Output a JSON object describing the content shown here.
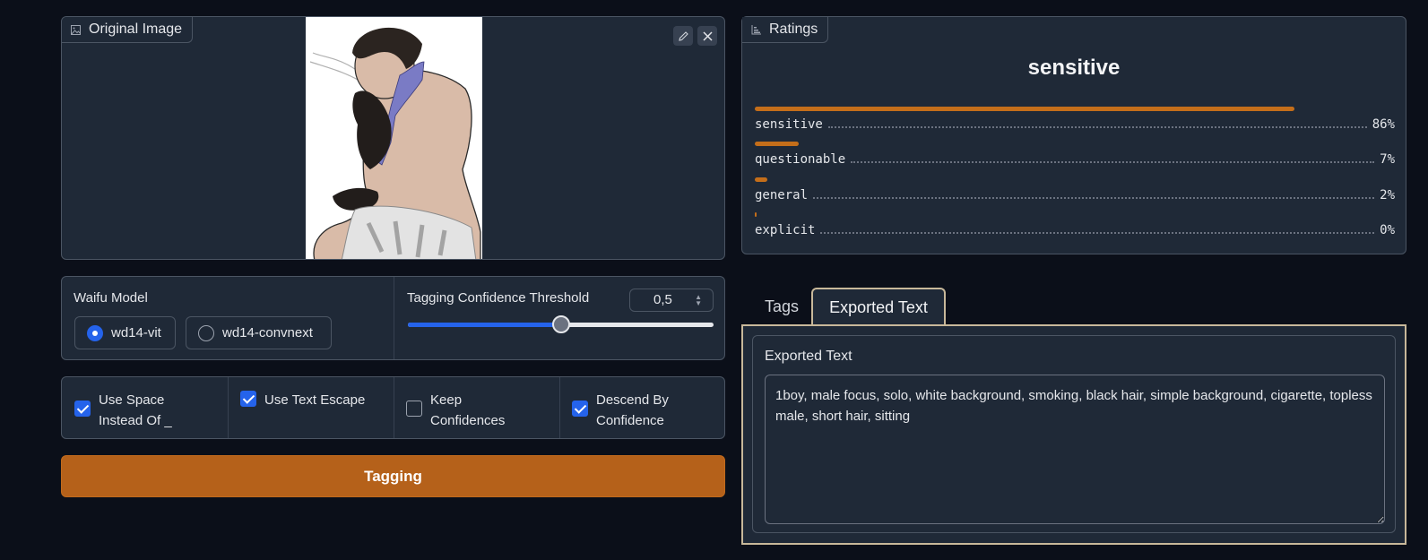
{
  "image_panel": {
    "label": "Original Image",
    "icons": {
      "label": "image-icon",
      "edit": "pencil-icon",
      "close": "close-icon"
    }
  },
  "ratings": {
    "label": "Ratings",
    "top_label": "sensitive",
    "items": [
      {
        "name": "sensitive",
        "percent_text": "86%",
        "value": 0.86
      },
      {
        "name": "questionable",
        "percent_text": "7%",
        "value": 0.07
      },
      {
        "name": "general",
        "percent_text": "2%",
        "value": 0.02
      },
      {
        "name": "explicit",
        "percent_text": "0%",
        "value": 0.0
      }
    ],
    "bar_color": "#c46e1a"
  },
  "model": {
    "title": "Waifu Model",
    "options": [
      {
        "label": "wd14-vit",
        "selected": true
      },
      {
        "label": "wd14-convnext",
        "selected": false
      }
    ]
  },
  "threshold": {
    "title": "Tagging Confidence Threshold",
    "value_text": "0,5",
    "value": 0.5,
    "min": 0,
    "max": 1
  },
  "options": [
    {
      "label_line1": "Use Space",
      "label_line2": "Instead Of _",
      "checked": true
    },
    {
      "label_line1": "Use Text Escape",
      "label_line2": "",
      "checked": true
    },
    {
      "label_line1": "Keep",
      "label_line2": "Confidences",
      "checked": false
    },
    {
      "label_line1": "Descend By",
      "label_line2": "Confidence",
      "checked": true
    }
  ],
  "tag_button": {
    "label": "Tagging",
    "color": "#b5611a"
  },
  "tabs": {
    "items": [
      "Tags",
      "Exported Text"
    ],
    "active": "Exported Text"
  },
  "exported": {
    "title": "Exported Text",
    "text": "1boy, male focus, solo, white background, smoking, black hair, simple background, cigarette, topless male, short hair, sitting"
  },
  "colors": {
    "accent": "#2563eb",
    "tab_border": "#c8b89a",
    "background": "#0b0f19",
    "panel": "#1f2937"
  }
}
